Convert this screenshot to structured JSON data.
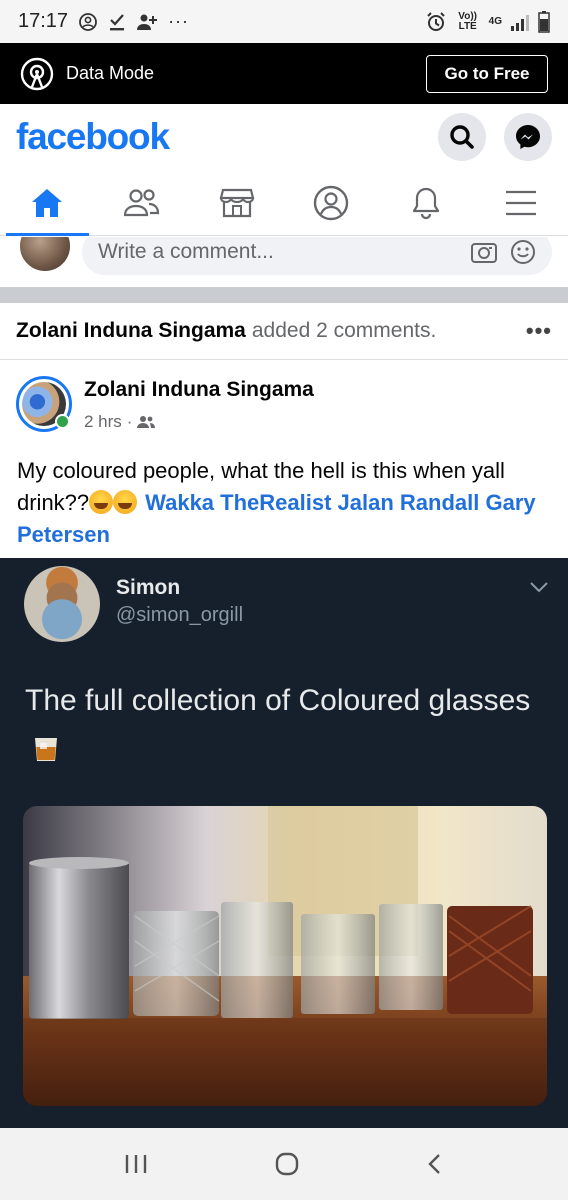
{
  "status_bar": {
    "time": "17:17",
    "more": "···",
    "volte": "Vo)) LTE",
    "network": "4G"
  },
  "data_banner": {
    "title": "Data Mode",
    "button": "Go to Free"
  },
  "header": {
    "logo": "facebook",
    "accent": "#1877f2"
  },
  "nav": {
    "tabs": [
      {
        "icon": "home-icon",
        "active": true
      },
      {
        "icon": "friends-icon",
        "active": false
      },
      {
        "icon": "marketplace-icon",
        "active": false
      },
      {
        "icon": "profile-icon",
        "active": false
      },
      {
        "icon": "notifications-icon",
        "active": false
      },
      {
        "icon": "menu-icon",
        "active": false
      }
    ]
  },
  "comment_box": {
    "placeholder": "Write a comment..."
  },
  "activity": {
    "who": "Zolani Induna Singama",
    "action": "added 2 comments.",
    "more": "•••"
  },
  "post": {
    "author": "Zolani Induna Singama",
    "time": "2 hrs",
    "dot": "·",
    "text_before": "My coloured people, what the hell is this  when yall drink??",
    "tags": "Wakka TheRealist Jalan Randall Gary Petersen"
  },
  "tweet": {
    "name": "Simon",
    "handle": "@simon_orgill",
    "text": "The full collection of Coloured glasses"
  }
}
